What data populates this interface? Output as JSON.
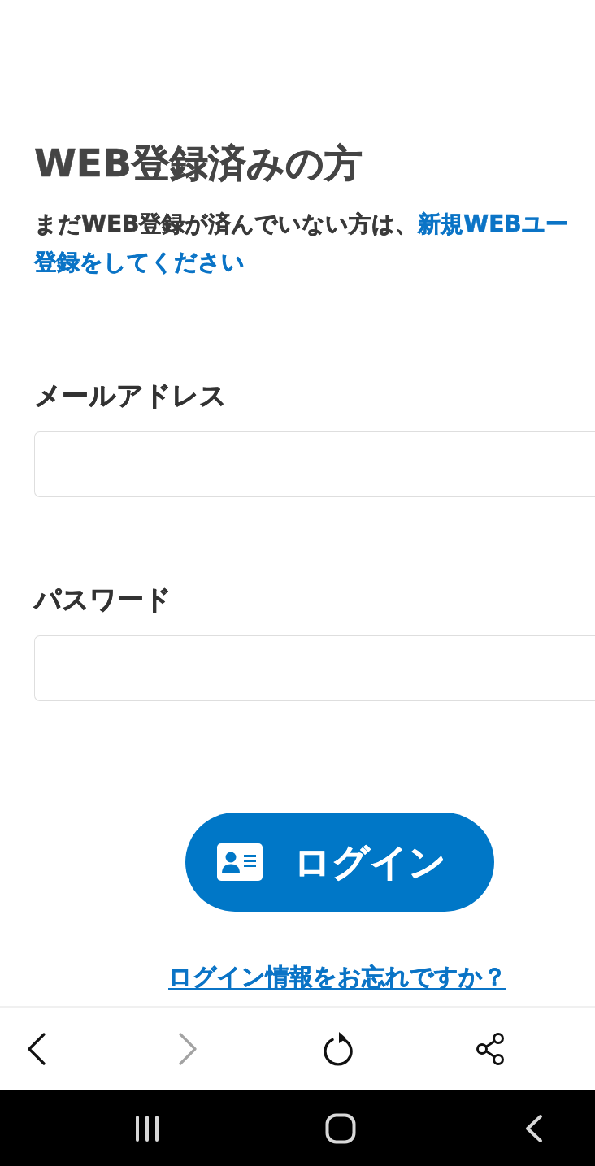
{
  "heading": "WEB登録済みの方",
  "intro": {
    "text": "まだWEB登録が済んでいない方は、",
    "link_lines": [
      "新規WEBユー",
      "登録をしてください"
    ]
  },
  "fields": [
    {
      "label": "メールアドレス"
    },
    {
      "label": "パスワード"
    }
  ],
  "login_button": {
    "label": "ログイン"
  },
  "forgot_link": "ログイン情報をお忘れですか？",
  "browser_toolbar": [
    {
      "kind": "back",
      "disabled": false
    },
    {
      "kind": "forward",
      "disabled": true
    },
    {
      "kind": "reload",
      "disabled": false
    },
    {
      "kind": "share",
      "disabled": false
    }
  ],
  "system_nav": [
    {
      "kind": "recents"
    },
    {
      "kind": "home"
    },
    {
      "kind": "back"
    }
  ]
}
